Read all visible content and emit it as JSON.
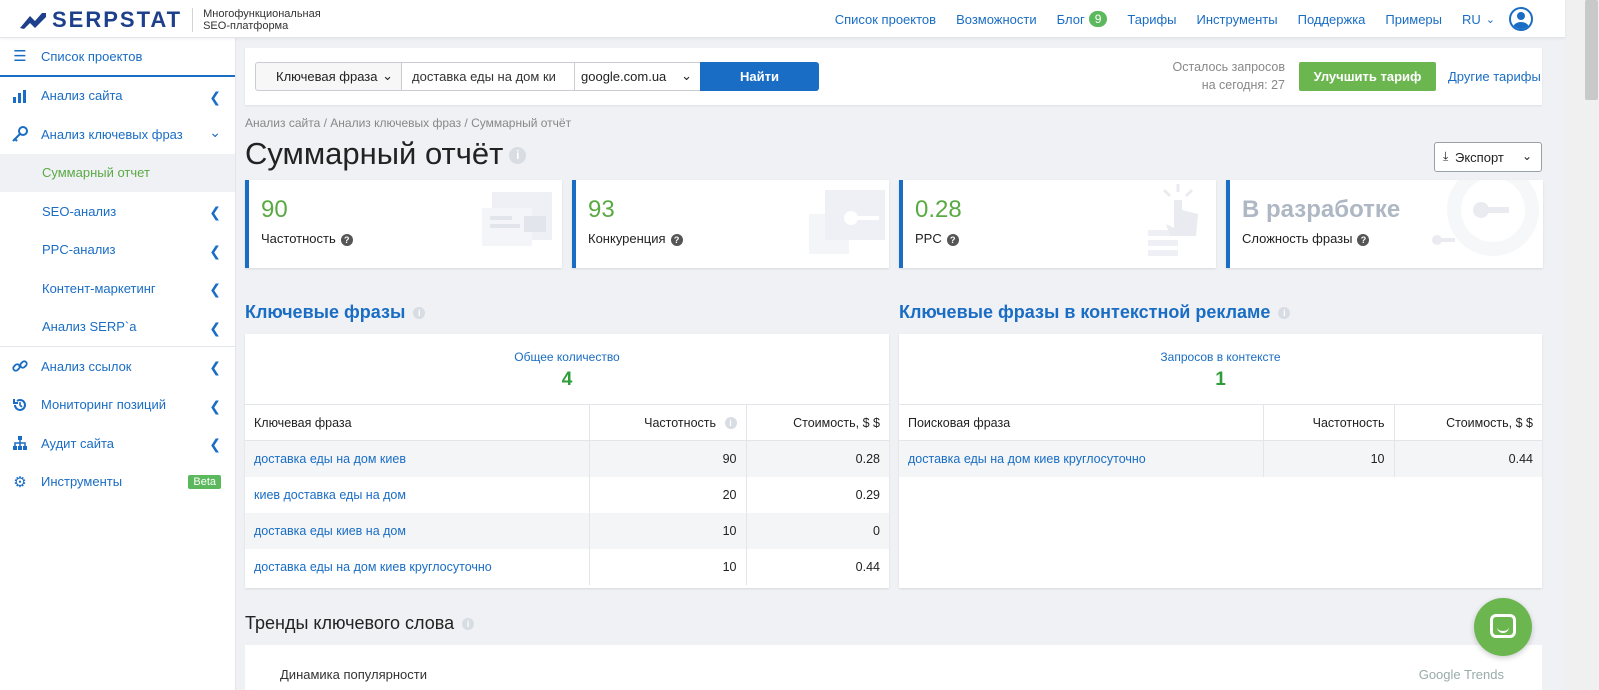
{
  "header": {
    "logo": "SERPSTAT",
    "tagline_line1": "Многофункциональная",
    "tagline_line2": "SEO-платформа",
    "nav": {
      "projects": "Список проектов",
      "features": "Возможности",
      "blog": "Блог",
      "blog_count": "9",
      "pricing": "Тарифы",
      "tools": "Инструменты",
      "support": "Поддержка",
      "examples": "Примеры",
      "lang": "RU"
    }
  },
  "sidebar": {
    "items": [
      {
        "label": "Список проектов",
        "icon": "menu-icon"
      },
      {
        "label": "Анализ сайта",
        "icon": "site-analysis-icon"
      },
      {
        "label": "Анализ ключевых фраз",
        "icon": "key-icon"
      },
      {
        "label": "Суммарный отчет"
      },
      {
        "label": "SEO-анализ"
      },
      {
        "label": "PPC-анализ"
      },
      {
        "label": "Контент-маркетинг"
      },
      {
        "label": "Анализ SERP`а"
      },
      {
        "label": "Анализ ссылок",
        "icon": "link-icon"
      },
      {
        "label": "Мониторинг позиций",
        "icon": "history-icon"
      },
      {
        "label": "Аудит сайта",
        "icon": "sitemap-icon"
      },
      {
        "label": "Инструменты",
        "icon": "gear-icon",
        "badge": "Beta"
      }
    ]
  },
  "search": {
    "type": "Ключевая фраза",
    "query": "доставка еды на дом ки",
    "engine": "google.com.ua",
    "find": "Найти",
    "quota_line1": "Осталось запросов",
    "quota_line2": "на сегодня: 27",
    "upgrade": "Улучшить тариф",
    "other_plans": "Другие тарифы"
  },
  "breadcrumb": "Анализ сайта / Анализ ключевых фраз / Суммарный отчёт",
  "page_title": "Суммарный отчёт",
  "export": "Экспорт",
  "cards": [
    {
      "value": "90",
      "label": "Частотность"
    },
    {
      "value": "93",
      "label": "Конкуренция"
    },
    {
      "value": "0.28",
      "label": "PPC"
    },
    {
      "value": "В разработке",
      "label": "Сложность фразы"
    }
  ],
  "keywords": {
    "title": "Ключевые фразы",
    "total_label": "Общее количество",
    "total": "4",
    "columns": [
      "Ключевая фраза",
      "Частотность",
      "Стоимость, $ $"
    ],
    "rows": [
      [
        "доставка еды на дом киев",
        "90",
        "0.28"
      ],
      [
        "киев доставка еды на дом",
        "20",
        "0.29"
      ],
      [
        "доставка еды киев на дом",
        "10",
        "0"
      ],
      [
        "доставка еды на дом киев круглосуточно",
        "10",
        "0.44"
      ]
    ]
  },
  "ppc": {
    "title": "Ключевые фразы в контекстной рекламе",
    "total_label": "Запросов в контексте",
    "total": "1",
    "columns": [
      "Поисковая фраза",
      "Частотность",
      "Стоимость, $ $"
    ],
    "rows": [
      [
        "доставка еды на дом киев круглосуточно",
        "10",
        "0.44"
      ]
    ]
  },
  "trends": {
    "title": "Тренды ключевого слова",
    "subtitle": "Динамика популярности",
    "source": "Google Trends"
  },
  "colors": {
    "brand_blue": "#1a6dc4",
    "green": "#6cb650",
    "value_green": "#5aaa44"
  }
}
